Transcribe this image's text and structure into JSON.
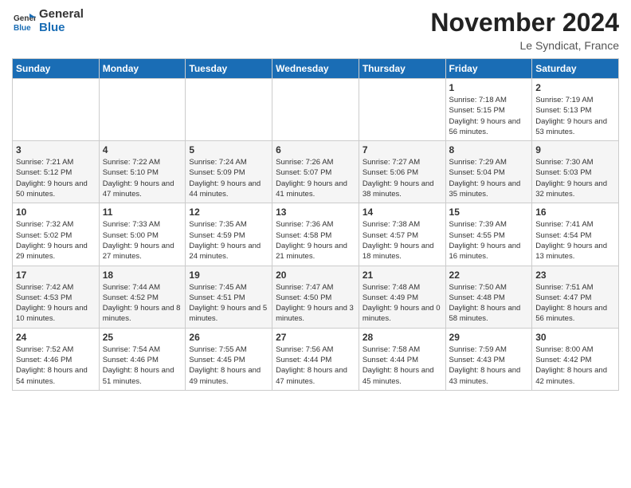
{
  "logo": {
    "line1": "General",
    "line2": "Blue"
  },
  "title": "November 2024",
  "location": "Le Syndicat, France",
  "days_of_week": [
    "Sunday",
    "Monday",
    "Tuesday",
    "Wednesday",
    "Thursday",
    "Friday",
    "Saturday"
  ],
  "weeks": [
    [
      {
        "day": "",
        "info": ""
      },
      {
        "day": "",
        "info": ""
      },
      {
        "day": "",
        "info": ""
      },
      {
        "day": "",
        "info": ""
      },
      {
        "day": "",
        "info": ""
      },
      {
        "day": "1",
        "info": "Sunrise: 7:18 AM\nSunset: 5:15 PM\nDaylight: 9 hours and 56 minutes."
      },
      {
        "day": "2",
        "info": "Sunrise: 7:19 AM\nSunset: 5:13 PM\nDaylight: 9 hours and 53 minutes."
      }
    ],
    [
      {
        "day": "3",
        "info": "Sunrise: 7:21 AM\nSunset: 5:12 PM\nDaylight: 9 hours and 50 minutes."
      },
      {
        "day": "4",
        "info": "Sunrise: 7:22 AM\nSunset: 5:10 PM\nDaylight: 9 hours and 47 minutes."
      },
      {
        "day": "5",
        "info": "Sunrise: 7:24 AM\nSunset: 5:09 PM\nDaylight: 9 hours and 44 minutes."
      },
      {
        "day": "6",
        "info": "Sunrise: 7:26 AM\nSunset: 5:07 PM\nDaylight: 9 hours and 41 minutes."
      },
      {
        "day": "7",
        "info": "Sunrise: 7:27 AM\nSunset: 5:06 PM\nDaylight: 9 hours and 38 minutes."
      },
      {
        "day": "8",
        "info": "Sunrise: 7:29 AM\nSunset: 5:04 PM\nDaylight: 9 hours and 35 minutes."
      },
      {
        "day": "9",
        "info": "Sunrise: 7:30 AM\nSunset: 5:03 PM\nDaylight: 9 hours and 32 minutes."
      }
    ],
    [
      {
        "day": "10",
        "info": "Sunrise: 7:32 AM\nSunset: 5:02 PM\nDaylight: 9 hours and 29 minutes."
      },
      {
        "day": "11",
        "info": "Sunrise: 7:33 AM\nSunset: 5:00 PM\nDaylight: 9 hours and 27 minutes."
      },
      {
        "day": "12",
        "info": "Sunrise: 7:35 AM\nSunset: 4:59 PM\nDaylight: 9 hours and 24 minutes."
      },
      {
        "day": "13",
        "info": "Sunrise: 7:36 AM\nSunset: 4:58 PM\nDaylight: 9 hours and 21 minutes."
      },
      {
        "day": "14",
        "info": "Sunrise: 7:38 AM\nSunset: 4:57 PM\nDaylight: 9 hours and 18 minutes."
      },
      {
        "day": "15",
        "info": "Sunrise: 7:39 AM\nSunset: 4:55 PM\nDaylight: 9 hours and 16 minutes."
      },
      {
        "day": "16",
        "info": "Sunrise: 7:41 AM\nSunset: 4:54 PM\nDaylight: 9 hours and 13 minutes."
      }
    ],
    [
      {
        "day": "17",
        "info": "Sunrise: 7:42 AM\nSunset: 4:53 PM\nDaylight: 9 hours and 10 minutes."
      },
      {
        "day": "18",
        "info": "Sunrise: 7:44 AM\nSunset: 4:52 PM\nDaylight: 9 hours and 8 minutes."
      },
      {
        "day": "19",
        "info": "Sunrise: 7:45 AM\nSunset: 4:51 PM\nDaylight: 9 hours and 5 minutes."
      },
      {
        "day": "20",
        "info": "Sunrise: 7:47 AM\nSunset: 4:50 PM\nDaylight: 9 hours and 3 minutes."
      },
      {
        "day": "21",
        "info": "Sunrise: 7:48 AM\nSunset: 4:49 PM\nDaylight: 9 hours and 0 minutes."
      },
      {
        "day": "22",
        "info": "Sunrise: 7:50 AM\nSunset: 4:48 PM\nDaylight: 8 hours and 58 minutes."
      },
      {
        "day": "23",
        "info": "Sunrise: 7:51 AM\nSunset: 4:47 PM\nDaylight: 8 hours and 56 minutes."
      }
    ],
    [
      {
        "day": "24",
        "info": "Sunrise: 7:52 AM\nSunset: 4:46 PM\nDaylight: 8 hours and 54 minutes."
      },
      {
        "day": "25",
        "info": "Sunrise: 7:54 AM\nSunset: 4:46 PM\nDaylight: 8 hours and 51 minutes."
      },
      {
        "day": "26",
        "info": "Sunrise: 7:55 AM\nSunset: 4:45 PM\nDaylight: 8 hours and 49 minutes."
      },
      {
        "day": "27",
        "info": "Sunrise: 7:56 AM\nSunset: 4:44 PM\nDaylight: 8 hours and 47 minutes."
      },
      {
        "day": "28",
        "info": "Sunrise: 7:58 AM\nSunset: 4:44 PM\nDaylight: 8 hours and 45 minutes."
      },
      {
        "day": "29",
        "info": "Sunrise: 7:59 AM\nSunset: 4:43 PM\nDaylight: 8 hours and 43 minutes."
      },
      {
        "day": "30",
        "info": "Sunrise: 8:00 AM\nSunset: 4:42 PM\nDaylight: 8 hours and 42 minutes."
      }
    ]
  ]
}
